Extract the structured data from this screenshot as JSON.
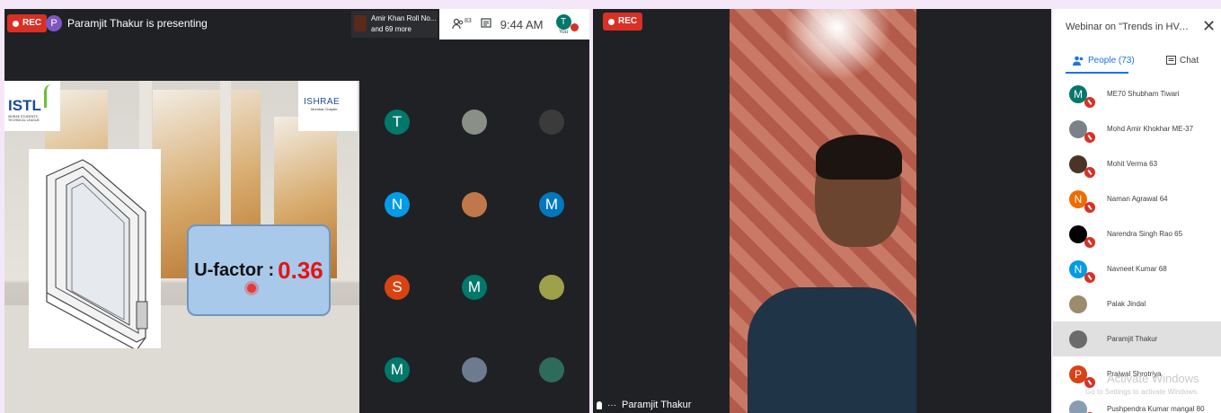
{
  "left": {
    "rec_label": "REC",
    "presenter_initial": "P",
    "presenting_text": "Paramjit Thakur is presenting",
    "popup_line1": "Amir Khan Roll No...",
    "popup_line2": "and 69 more",
    "participant_count": "83",
    "time": "9:44 AM",
    "self_initial": "T",
    "self_label": "You",
    "slide": {
      "logo_left": "ISTL",
      "logo_left_sub": "ISHRAE STUDENTS TECHNICAL LEAGUE",
      "logo_right": "ISHRAE",
      "logo_right_sub": "Mumbai Chapter",
      "ufactor_label": "U-factor :",
      "ufactor_value": "0.36"
    },
    "grid": [
      {
        "initial": "T",
        "color": "#00796b"
      },
      {
        "initial": "",
        "color": "#8a8f88",
        "icon": "photo-avatar-icon"
      },
      {
        "initial": "",
        "color": "#3b3b3b",
        "icon": "photo-avatar-icon"
      },
      {
        "initial": "N",
        "color": "#039be5"
      },
      {
        "initial": "",
        "color": "#c0784a",
        "icon": "photo-avatar-icon"
      },
      {
        "initial": "M",
        "color": "#0277bd"
      },
      {
        "initial": "S",
        "color": "#d84315"
      },
      {
        "initial": "M",
        "color": "#00796b"
      },
      {
        "initial": "",
        "color": "#9ea04a",
        "icon": "photo-avatar-icon"
      },
      {
        "initial": "M",
        "color": "#00796b"
      },
      {
        "initial": "",
        "color": "#6d7b8f",
        "icon": "photo-avatar-icon"
      },
      {
        "initial": "",
        "color": "#2f6b5a",
        "icon": "photo-avatar-icon"
      }
    ]
  },
  "center": {
    "rec_label": "REC",
    "speaker_name": "Paramjit Thakur"
  },
  "right": {
    "title": "Webinar on \"Trends in HVAC Indu...",
    "tab_people": "People (73)",
    "tab_chat": "Chat",
    "participants": [
      {
        "initial": "M",
        "color": "#00796b",
        "name": "ME70 Shubham Tiwari",
        "muted": true
      },
      {
        "initial": "",
        "color": "#7a8188",
        "name": "Mohd Amir Khokhar ME-37",
        "muted": true
      },
      {
        "initial": "",
        "color": "#4a3428",
        "name": "Mohit Verma 63",
        "muted": true
      },
      {
        "initial": "N",
        "color": "#ef6c00",
        "name": "Naman Agrawal 64",
        "muted": true
      },
      {
        "initial": "",
        "color": "#000000",
        "name": "Narendra Singh Rao 65",
        "muted": true
      },
      {
        "initial": "N",
        "color": "#039be5",
        "name": "Navneet Kumar 68",
        "muted": true
      },
      {
        "initial": "",
        "color": "#9a8c6c",
        "name": "Palak Jindal",
        "muted": false
      },
      {
        "initial": "",
        "color": "#6b6b6b",
        "name": "Paramjit Thakur",
        "muted": false,
        "selected": true
      },
      {
        "initial": "P",
        "color": "#d84315",
        "name": "Prajwal Shrotriya",
        "muted": true
      },
      {
        "initial": "",
        "color": "#8a9cb0",
        "name": "Pushpendra Kumar mangal 80",
        "muted": true
      }
    ],
    "watermark": "Activate Windows",
    "watermark_sub": "Go to Settings to activate Windows."
  }
}
